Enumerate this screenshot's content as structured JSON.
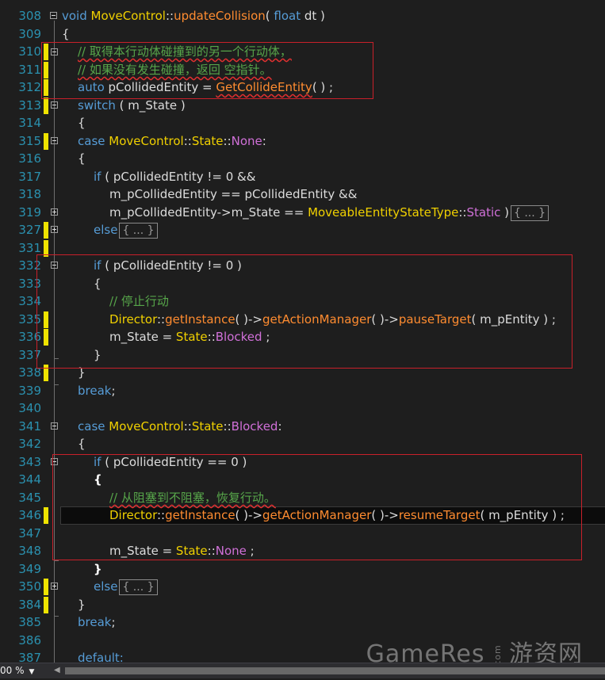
{
  "editor": {
    "line_numbers": [
      "308",
      "309",
      "310",
      "311",
      "312",
      "313",
      "314",
      "315",
      "316",
      "317",
      "318",
      "319",
      "327",
      "331",
      "332",
      "333",
      "334",
      "335",
      "336",
      "337",
      "338",
      "339",
      "340",
      "341",
      "342",
      "343",
      "344",
      "345",
      "346",
      "347",
      "348",
      "349",
      "350",
      "384",
      "385",
      "386",
      "387"
    ],
    "code": {
      "l308": {
        "a": "void ",
        "b": "MoveControl",
        "c": "::",
        "d": "updateCollision",
        "e": "( ",
        "f": "float ",
        "g": "dt )"
      },
      "l309": "{",
      "l310": "// 取得本行动体碰撞到的另一个行动体，",
      "l311": "// 如果没有发生碰撞，返回 空指针。",
      "l312": {
        "a": "auto ",
        "b": "pCollidedEntity = ",
        "c": "GetCollideEntity",
        "d": "( ) ;"
      },
      "l313": {
        "a": "switch ",
        "b": "( m_State )"
      },
      "l314": "{",
      "l315": {
        "a": "case ",
        "b": "MoveControl",
        "c": "::",
        "d": "State",
        "e": "::",
        "f": "None",
        ":": ":"
      },
      "l316": "{",
      "l317": {
        "a": "if ",
        "b": "( pCollidedEntity != 0 &&"
      },
      "l318": "m_pCollidedEntity == pCollidedEntity &&",
      "l319": {
        "a": "m_pCollidedEntity->m_State == ",
        "b": "MoveableEntityStateType",
        "c": "::",
        "d": "Static ",
        "e": ")",
        "f": "{ ... }"
      },
      "l327": {
        "a": "else",
        "b": "{ ... }"
      },
      "l332": {
        "a": "if ",
        "b": "( pCollidedEntity != 0 )"
      },
      "l333": "{",
      "l334": "// 停止行动",
      "l335": {
        "a": "Director",
        "b": "::",
        "c": "getInstance",
        "d": "( )->",
        "e": "getActionManager",
        "f": "( )->",
        "g": "pauseTarget",
        "h": "( m_pEntity ) ;"
      },
      "l336": {
        "a": "m_State = ",
        "b": "State",
        "c": "::",
        "d": "Blocked",
        "e": " ;"
      },
      "l337": "}",
      "l338": "}",
      "l339": {
        "a": "break",
        ";": ";"
      },
      "l341": {
        "a": "case ",
        "b": "MoveControl",
        "c": "::",
        "d": "State",
        "e": "::",
        "f": "Blocked",
        ":": ":"
      },
      "l342": "{",
      "l343": {
        "a": "if ",
        "b": "( pCollidedEntity == 0 )"
      },
      "l344": "{",
      "l345": "// 从阻塞到不阻塞，恢复行动。",
      "l346": {
        "a": "Director",
        "b": "::",
        "c": "getInstance",
        "d": "( )->",
        "e": "getActionManager",
        "f": "( )->",
        "g": "resumeTarget",
        "h": "( m_pEntity ) ;"
      },
      "l348": {
        "a": "m_State = ",
        "b": "State",
        "c": "::",
        "d": "None",
        "e": " ;"
      },
      "l349": "}",
      "l350": {
        "a": "else",
        "b": "{ ... }"
      },
      "l384": "}",
      "l385": {
        "a": "break",
        ";": ";"
      },
      "l387": "default:"
    }
  },
  "watermark": {
    "main": "GameRes",
    "com": "com",
    "cn": "游资网"
  },
  "statusbar": {
    "zoom": "00 %",
    "zoom_arrow": "▼",
    "scroll_left": "◀"
  },
  "colors": {
    "keyword": "#569cd6",
    "class": "#f0d000",
    "function": "#ff8c30",
    "enum": "#d070d8",
    "comment": "#57a64a",
    "line_number": "#2b91af",
    "change_marker": "#efe300",
    "highlight_box": "#c8202a"
  }
}
